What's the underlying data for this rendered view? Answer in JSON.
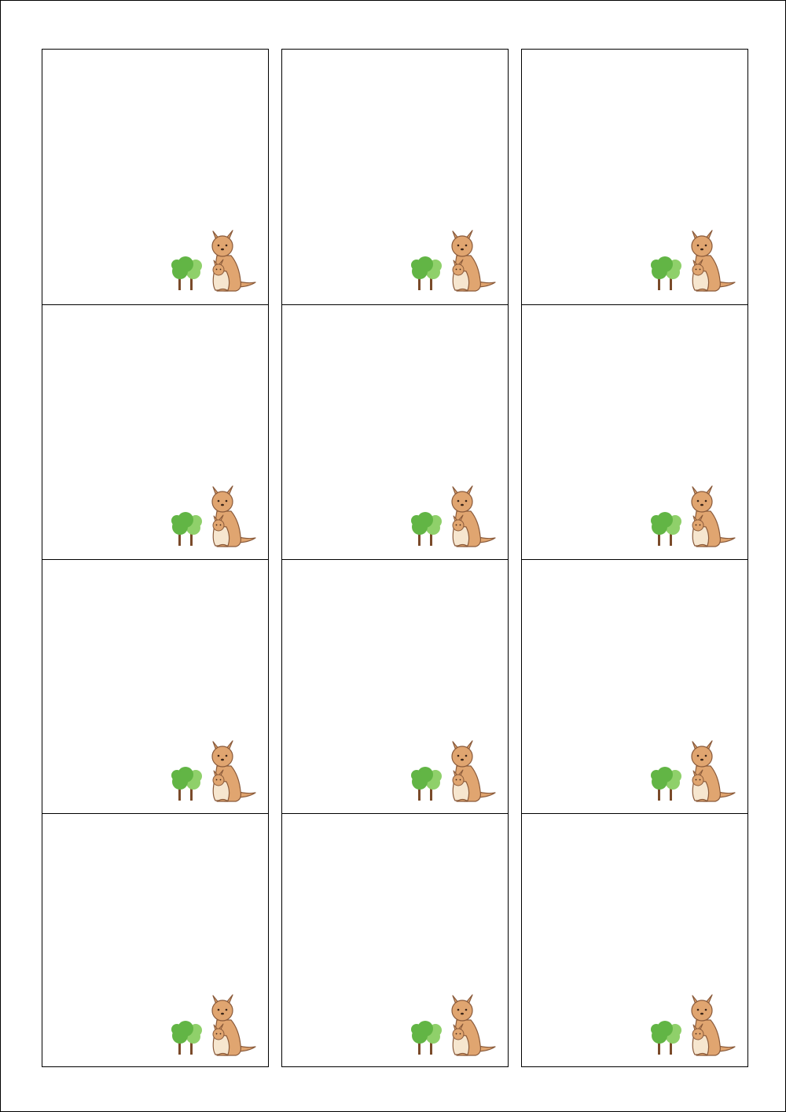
{
  "sheet": {
    "columns": 3,
    "rows": 4,
    "card_label": "name card",
    "illustration": [
      "tree-icon",
      "kangaroo-with-joey-icon"
    ]
  },
  "colors": {
    "border": "#000000",
    "kangaroo_fill": "#e0a570",
    "kangaroo_outline": "#8a5a3a",
    "belly": "#f6e6cf",
    "tree_light": "#8fd06a",
    "tree_dark": "#62b545",
    "trunk": "#7a4a2a"
  }
}
